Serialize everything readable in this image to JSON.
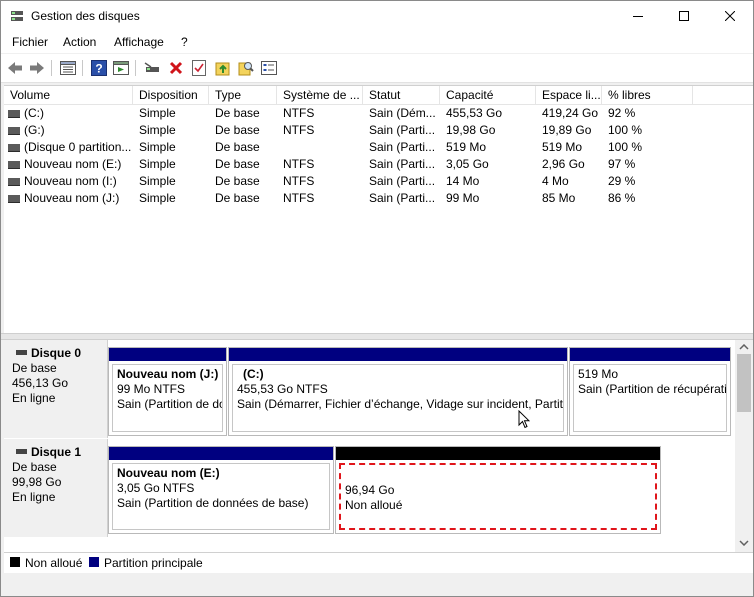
{
  "window": {
    "title": "Gestion des disques",
    "controls": {
      "minimize": "minimize-icon",
      "maximize": "maximize-icon",
      "close": "close-icon"
    }
  },
  "menu": [
    "Fichier",
    "Action",
    "Affichage",
    "?"
  ],
  "toolbar": [
    "back-arrow-icon",
    "forward-arrow-icon",
    "list-view-icon",
    "help-icon",
    "properties-icon",
    "connect-drive-icon",
    "delete-icon",
    "checklist-icon",
    "import-icon",
    "search-icon",
    "settings-list-icon"
  ],
  "volumes": {
    "columns": [
      "Volume",
      "Disposition",
      "Type",
      "Système de ...",
      "Statut",
      "Capacité",
      "Espace li...",
      "% libres"
    ],
    "rows": [
      [
        "(C:)",
        "Simple",
        "De base",
        "NTFS",
        "Sain (Dém...",
        "455,53 Go",
        "419,24 Go",
        "92 %"
      ],
      [
        "(G:)",
        "Simple",
        "De base",
        "NTFS",
        "Sain (Parti...",
        "19,98 Go",
        "19,89 Go",
        "100 %"
      ],
      [
        "(Disque 0 partition...",
        "Simple",
        "De base",
        "",
        "Sain (Parti...",
        "519 Mo",
        "519 Mo",
        "100 %"
      ],
      [
        "Nouveau nom (E:)",
        "Simple",
        "De base",
        "NTFS",
        "Sain (Parti...",
        "3,05 Go",
        "2,96 Go",
        "97 %"
      ],
      [
        "Nouveau nom (I:)",
        "Simple",
        "De base",
        "NTFS",
        "Sain (Parti...",
        "14 Mo",
        "4 Mo",
        "29 %"
      ],
      [
        "Nouveau nom (J:)",
        "Simple",
        "De base",
        "NTFS",
        "Sain (Parti...",
        "99 Mo",
        "85 Mo",
        "86 %"
      ]
    ]
  },
  "disks": {
    "disk0": {
      "name": "Disque 0",
      "type": "De base",
      "size": "456,13 Go",
      "status": "En ligne",
      "partitions": [
        {
          "name": "Nouveau nom  (J:)",
          "size": "99 Mo NTFS",
          "status": "Sain (Partition de do"
        },
        {
          "name": "(C:)",
          "size": "455,53 Go NTFS",
          "status": "Sain (Démarrer, Fichier d’échange, Vidage sur incident, Partitio"
        },
        {
          "name": "",
          "size": "519 Mo",
          "status": "Sain (Partition de récupération)"
        }
      ]
    },
    "disk1": {
      "name": "Disque 1",
      "type": "De base",
      "size": "99,98 Go",
      "status": "En ligne",
      "partitions": [
        {
          "name": "Nouveau nom  (E:)",
          "size": "3,05 Go NTFS",
          "status": "Sain (Partition de données de base)"
        },
        {
          "name": "",
          "size": "96,94 Go",
          "status": "Non alloué"
        }
      ]
    }
  },
  "legend": [
    {
      "label": "Non alloué",
      "color": "#000000"
    },
    {
      "label": "Partition principale",
      "color": "#000080"
    }
  ],
  "colors": {
    "primary_partition": "#000080",
    "unallocated": "#000000",
    "selection_outline": "#e0151b"
  }
}
